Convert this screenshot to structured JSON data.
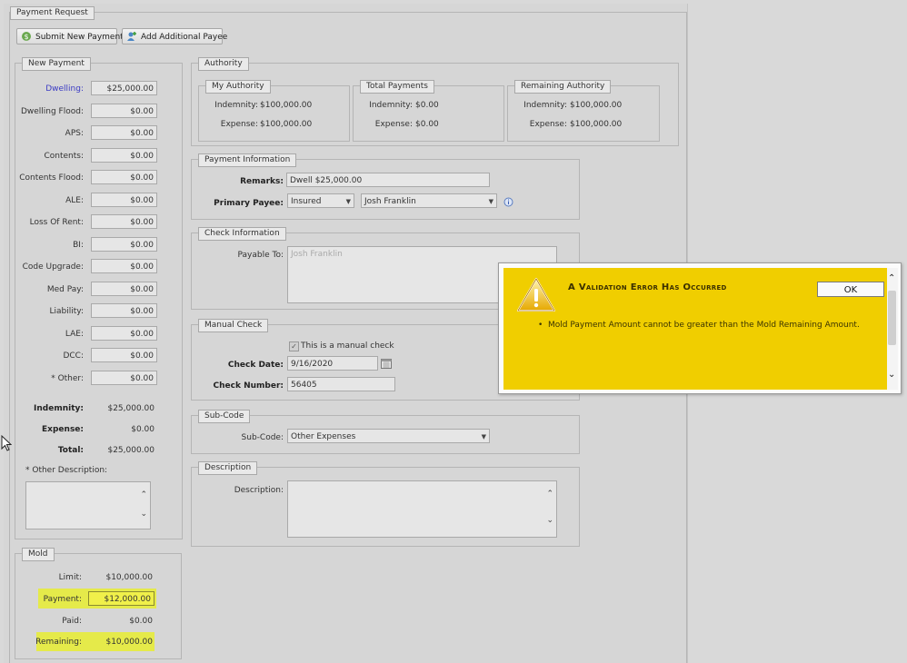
{
  "panel": {
    "title": "Payment Request"
  },
  "toolbar": {
    "submit_label": "Submit New Payment",
    "add_payee_label": "Add Additional Payee"
  },
  "new_payment": {
    "title": "New Payment",
    "rows": [
      {
        "label": "Dwelling:",
        "value": "$25,000.00"
      },
      {
        "label": "Dwelling Flood:",
        "value": "$0.00"
      },
      {
        "label": "APS:",
        "value": "$0.00"
      },
      {
        "label": "Contents:",
        "value": "$0.00"
      },
      {
        "label": "Contents Flood:",
        "value": "$0.00"
      },
      {
        "label": "ALE:",
        "value": "$0.00"
      },
      {
        "label": "Loss Of Rent:",
        "value": "$0.00"
      },
      {
        "label": "BI:",
        "value": "$0.00"
      },
      {
        "label": "Code Upgrade:",
        "value": "$0.00"
      },
      {
        "label": "Med Pay:",
        "value": "$0.00"
      },
      {
        "label": "Liability:",
        "value": "$0.00"
      },
      {
        "label": "LAE:",
        "value": "$0.00"
      },
      {
        "label": "DCC:",
        "value": "$0.00"
      },
      {
        "label": "* Other:",
        "value": "$0.00"
      }
    ],
    "totals": [
      {
        "label": "Indemnity:",
        "value": "$25,000.00"
      },
      {
        "label": "Expense:",
        "value": "$0.00"
      },
      {
        "label": "Total:",
        "value": "$25,000.00"
      }
    ],
    "other_description_label": "* Other Description:",
    "link_color": "#3b3bc4"
  },
  "mold": {
    "title": "Mold",
    "limit_label": "Limit:",
    "limit_value": "$10,000.00",
    "payment_label": "Payment:",
    "payment_value": "$12,000.00",
    "paid_label": "Paid:",
    "paid_value": "$0.00",
    "remaining_label": "Remaining:",
    "remaining_value": "$10,000.00",
    "highlight_color": "#e5ea4a"
  },
  "authority": {
    "title": "Authority",
    "my": {
      "title": "My Authority",
      "indemnity_label": "Indemnity:",
      "indemnity": "$100,000.00",
      "expense_label": "Expense:",
      "expense": "$100,000.00"
    },
    "total": {
      "title": "Total Payments",
      "indemnity_label": "Indemnity:",
      "indemnity": "$0.00",
      "expense_label": "Expense:",
      "expense": "$0.00"
    },
    "remaining": {
      "title": "Remaining Authority",
      "indemnity_label": "Indemnity:",
      "indemnity": "$100,000.00",
      "expense_label": "Expense:",
      "expense": "$100,000.00"
    }
  },
  "payment_info": {
    "title": "Payment Information",
    "remarks_label": "Remarks:",
    "remarks_value": "Dwell $25,000.00",
    "payee_label": "Primary Payee:",
    "payee_type": "Insured",
    "payee_name": "Josh Franklin"
  },
  "check_info": {
    "title": "Check Information",
    "payable_label": "Payable To:",
    "payable_value": "Josh Franklin"
  },
  "manual_check": {
    "title": "Manual Check",
    "checkbox_label": "This is a manual check",
    "date_label": "Check Date:",
    "date_value": "9/16/2020",
    "number_label": "Check Number:",
    "number_value": "56405"
  },
  "sub_code": {
    "title": "Sub-Code",
    "label": "Sub-Code:",
    "value": "Other Expenses"
  },
  "description": {
    "title": "Description",
    "label": "Description:"
  },
  "dialog": {
    "title": "A Validation Error Has Occurred",
    "ok_label": "OK",
    "message": "Mold Payment Amount cannot be greater than the Mold Remaining Amount.",
    "bg_color": "#f0ce00"
  }
}
